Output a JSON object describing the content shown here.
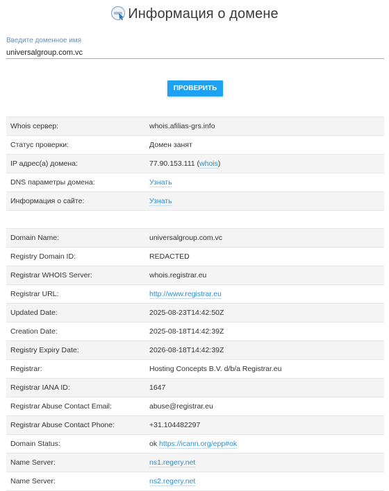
{
  "page": {
    "title": "Информация о домене"
  },
  "form": {
    "label": "Введите доменное имя",
    "value": "universalgroup.com.vc",
    "button": "ПРОВЕРИТЬ"
  },
  "summary": {
    "whois_label": "Whois сервер:",
    "whois_value": "whois.afilias-grs.info",
    "status_label": "Статус проверки:",
    "status_value": "Домен занят",
    "ip_label": "IP адрес(а) домена:",
    "ip_value": "77.90.153.111",
    "ip_open": " (",
    "ip_link": "whois",
    "ip_close": ")",
    "dns_label": "DNS параметры домена:",
    "dns_link": "Узнать",
    "site_label": "Информация о сайте:",
    "site_link": "Узнать"
  },
  "whois": [
    {
      "key": "Domain Name:",
      "value": "universalgroup.com.vc"
    },
    {
      "key": "Registry Domain ID:",
      "value": "REDACTED"
    },
    {
      "key": "Registrar WHOIS Server:",
      "value": "whois.registrar.eu"
    },
    {
      "key": "Registrar URL:",
      "link": "http://www.registrar.eu"
    },
    {
      "key": "Updated Date:",
      "value": "2025-08-23T14:42:50Z"
    },
    {
      "key": "Creation Date:",
      "value": "2025-08-18T14:42:39Z"
    },
    {
      "key": "Registry Expiry Date:",
      "value": "2026-08-18T14:42:39Z"
    },
    {
      "key": "Registrar:",
      "value": "Hosting Concepts B.V. d/b/a Registrar.eu"
    },
    {
      "key": "Registrar IANA ID:",
      "value": "1647"
    },
    {
      "key": "Registrar Abuse Contact Email:",
      "value": "abuse@registrar.eu"
    },
    {
      "key": "Registrar Abuse Contact Phone:",
      "value": "+31.104482297"
    },
    {
      "key": "Domain Status:",
      "value": "ok ",
      "link": "https://icann.org/epp#ok"
    },
    {
      "key": "Name Server:",
      "link": "ns1.regery.net"
    },
    {
      "key": "Name Server:",
      "link": "ns2.regery.net"
    }
  ]
}
